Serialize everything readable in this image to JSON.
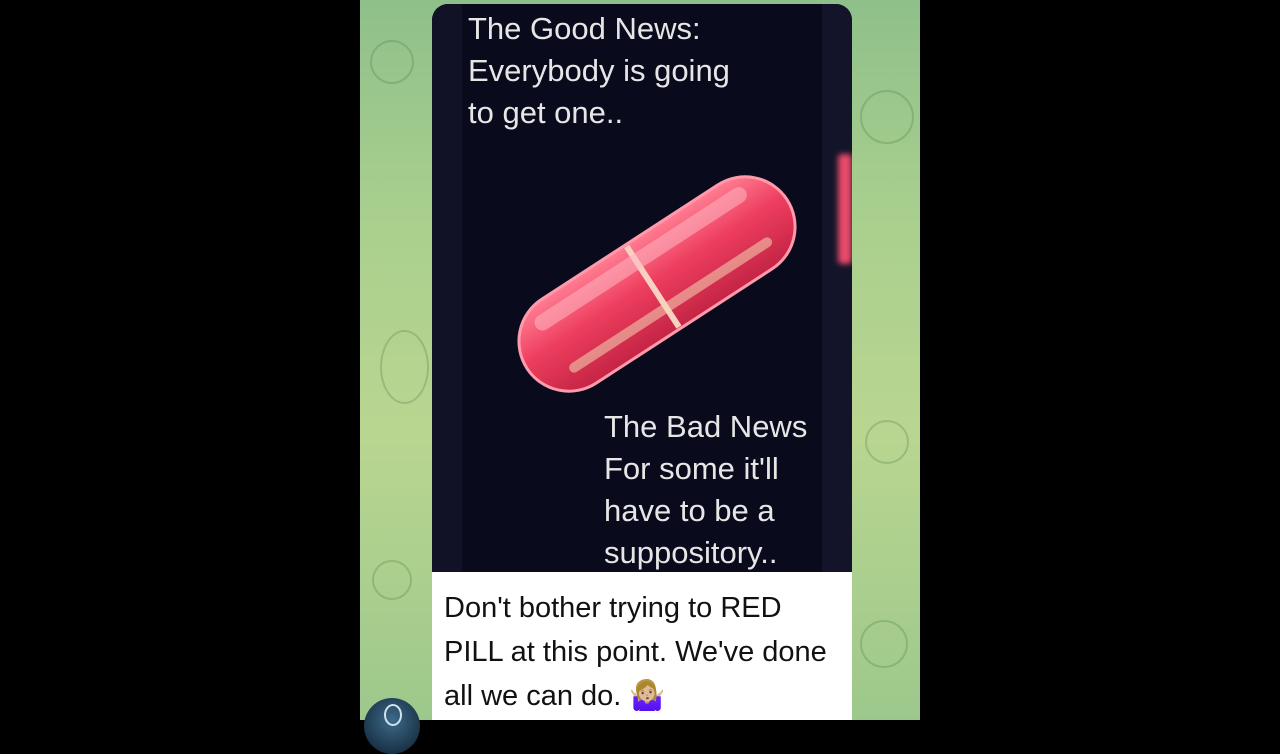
{
  "meme": {
    "top_text": "The Good News:\nEverybody is going\nto get one..",
    "bottom_lines": [
      "The Bad News",
      "For some it'll",
      "have to be a",
      "suppository.."
    ]
  },
  "message": {
    "caption": "Don't bother trying to RED PILL at this point.  We've done all we can do. 🤷🏼‍♀️"
  },
  "colors": {
    "pill": "#ee3e5f",
    "meme_background": "#090a1c",
    "chat_background": "#a9cf8e"
  },
  "icons": {
    "shrug": "person-shrugging-emoji"
  }
}
